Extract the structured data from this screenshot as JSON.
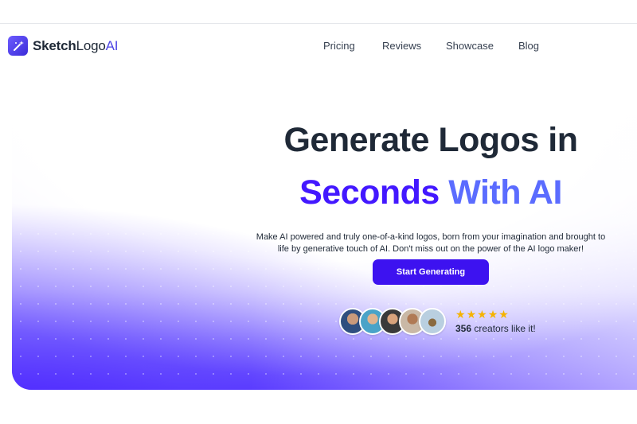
{
  "header": {
    "brand": {
      "part1": "Sketch",
      "part2": "Logo",
      "part3": "AI"
    },
    "nav": [
      {
        "label": "Pricing"
      },
      {
        "label": "Reviews"
      },
      {
        "label": "Showcase"
      },
      {
        "label": "Blog"
      }
    ]
  },
  "hero": {
    "title_line1": "Generate Logos in",
    "title_line2_part1": "Seconds",
    "title_line2_part2": "With AI",
    "description": "Make AI powered and truly one-of-a-kind logos, born from your imagination and brought to life by generative touch of AI. Don't miss out on the power of the AI logo maker!",
    "cta_label": "Start Generating",
    "social_proof": {
      "stars": [
        "★",
        "★",
        "★",
        "★",
        "★"
      ],
      "count": "356",
      "text": "creators like it!"
    }
  },
  "colors": {
    "accent": "#3d12f0",
    "title_purple": "#4318ff",
    "title_blue": "#5b6cff",
    "star": "#f5b300"
  }
}
